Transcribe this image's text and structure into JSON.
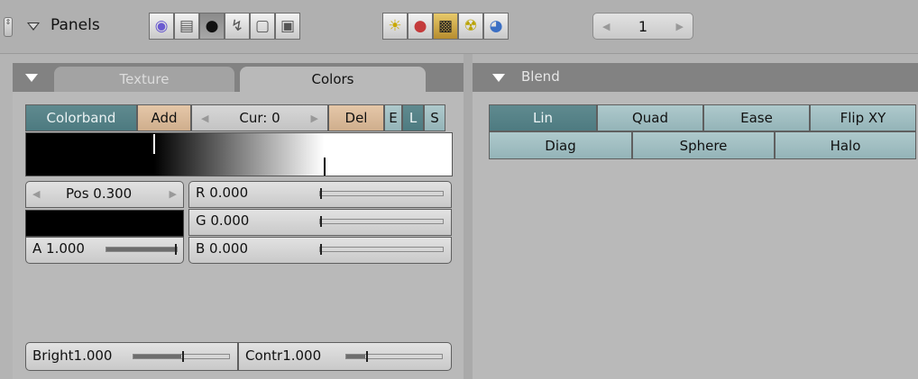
{
  "header": {
    "updown_icon": "up-down-arrows-icon",
    "collapse_icon": "triangle-down-icon",
    "panels_label": "Panels",
    "context_icons": [
      "logic-icon",
      "script-icon",
      "shading-icon",
      "object-icon",
      "editing-icon",
      "scene-icon"
    ],
    "shading_icons": [
      "lamp-icon",
      "material-icon",
      "texture-icon",
      "radiosity-icon",
      "world-icon"
    ],
    "frame_value": "1",
    "frame_left": "◀",
    "frame_right": "▶"
  },
  "texture_panel": {
    "tab_texture": "Texture",
    "tab_colors": "Colors",
    "colorband_label": "Colorband",
    "add_label": "Add",
    "cur_label": "Cur: 0",
    "del_label": "Del",
    "e_label": "E",
    "l_label": "L",
    "s_label": "S",
    "pos_label": "Pos 0.300",
    "r_label": "R 0.000",
    "g_label": "G 0.000",
    "b_label": "B 0.000",
    "a_label": "A 1.000",
    "bright_label": "Bright1.000",
    "contr_label": "Contr1.000",
    "arrow_left": "◀",
    "arrow_right": "▶"
  },
  "blend_panel": {
    "title": "Blend",
    "row1": [
      "Lin",
      "Quad",
      "Ease",
      "Flip XY"
    ],
    "row2": [
      "Diag",
      "Sphere",
      "Halo"
    ]
  },
  "colors": {
    "panel_bg": "#b9b9b9",
    "header_bg": "#828282",
    "selected_button": "#5f8a8f",
    "radio_button": "#aec9cc",
    "add_del_button": "#e5c7a8"
  }
}
